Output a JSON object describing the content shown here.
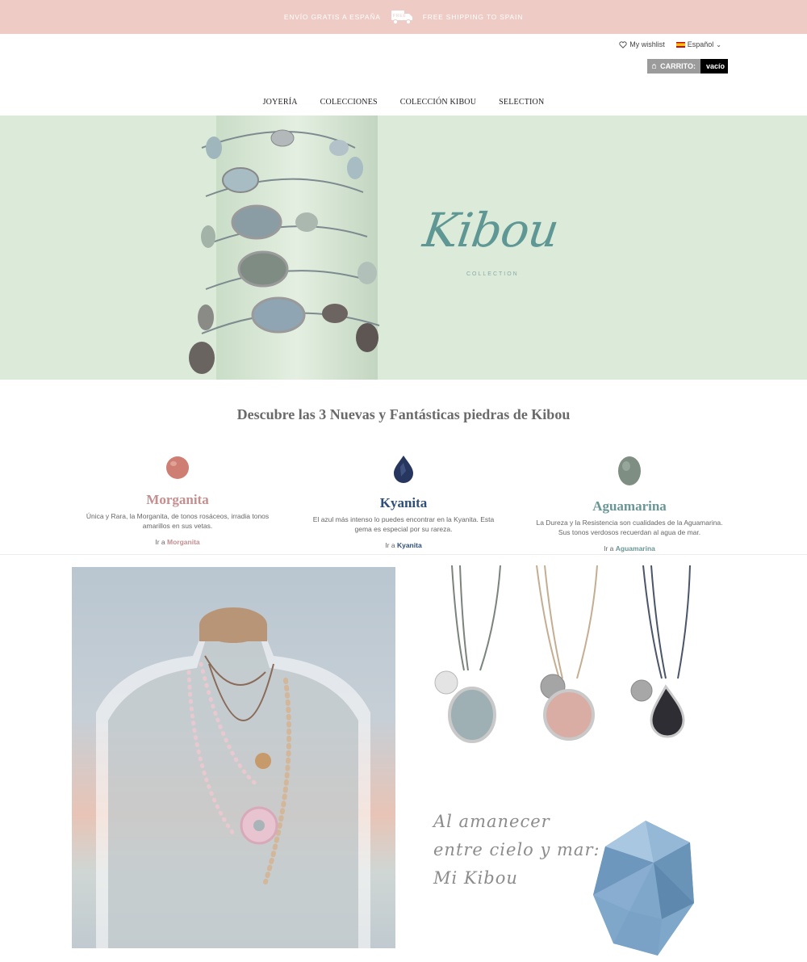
{
  "shipping": {
    "left_text": "ENVÍO GRATIS A ESPAÑA",
    "badge": "FREE",
    "right_text": "FREE SHIPPING TO SPAIN"
  },
  "header": {
    "wishlist": "My wishlist",
    "language": "Español",
    "cart_label": "CARRITO:",
    "cart_value": "vacío"
  },
  "nav": {
    "items": [
      {
        "label": "JOYERÍA"
      },
      {
        "label": "COLECCIONES"
      },
      {
        "label": "COLECCIÓN KIBOU"
      },
      {
        "label": "SELECTION"
      }
    ]
  },
  "hero": {
    "brand": "Kibou",
    "brand_sub": "COLLECTION"
  },
  "section": {
    "title": "Descubre las 3 Nuevas y Fantásticas piedras de Kibou"
  },
  "stones": [
    {
      "name": "Morganita",
      "color": "#c58e8f",
      "gem_color": "#cf7e73",
      "description": "Única y Rara, la Morganita, de tonos rosáceos, irradia tonos amarillos en sus vetas.",
      "link_prefix": "Ir a",
      "link_target": "Morganita"
    },
    {
      "name": "Kyanita",
      "color": "#2f4f7a",
      "gem_color": "#27365f",
      "description": "El azul más intenso lo puedes encontrar en la Kyanita. Esta gema es especial por su rareza.",
      "link_prefix": "Ir a",
      "link_target": "Kyanita"
    },
    {
      "name": "Aguamarina",
      "color": "#6b9696",
      "gem_color": "#7e8e82",
      "description": "La Dureza y la Resistencia son cualidades de la Aguamarina. Sus tonos verdosos recuerdan al agua de mar.",
      "link_prefix": "Ir a",
      "link_target": "Aguamarina"
    }
  ],
  "promo": {
    "line1": "Al amanecer",
    "line2": "entre cielo y mar:",
    "line3": "Mi Kibou"
  },
  "colors": {
    "shipbar": "#efcbc5",
    "hero_bg": "#dcebd9",
    "brand": "#5f9794"
  }
}
